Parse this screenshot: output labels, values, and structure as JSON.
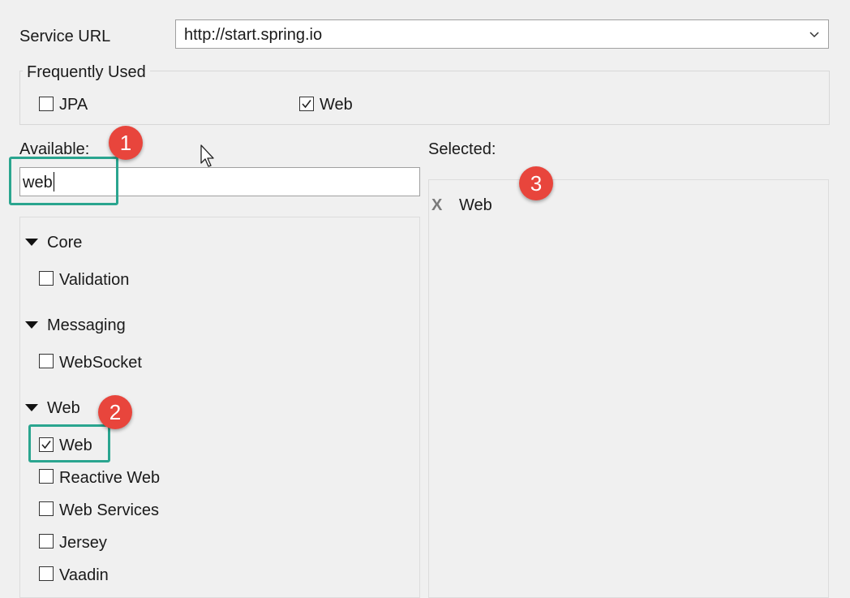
{
  "service_url": {
    "label": "Service URL",
    "value": "http://start.spring.io"
  },
  "frequently_used": {
    "title": "Frequently Used",
    "items": [
      {
        "label": "JPA",
        "checked": false
      },
      {
        "label": "Web",
        "checked": true
      }
    ]
  },
  "available": {
    "label": "Available:",
    "search_value": "web",
    "categories": [
      {
        "name": "Core",
        "items": [
          {
            "label": "Validation",
            "checked": false
          }
        ]
      },
      {
        "name": "Messaging",
        "items": [
          {
            "label": "WebSocket",
            "checked": false
          }
        ]
      },
      {
        "name": "Web",
        "items": [
          {
            "label": "Web",
            "checked": true
          },
          {
            "label": "Reactive Web",
            "checked": false
          },
          {
            "label": "Web Services",
            "checked": false
          },
          {
            "label": "Jersey",
            "checked": false
          },
          {
            "label": "Vaadin",
            "checked": false
          }
        ]
      }
    ]
  },
  "selected": {
    "label": "Selected:",
    "remove_glyph": "X",
    "items": [
      {
        "label": "Web"
      }
    ]
  },
  "annotations": {
    "badge_1": "1",
    "badge_2": "2",
    "badge_3": "3",
    "badge_color": "#e8453c",
    "highlight_color": "#2aa58f"
  }
}
